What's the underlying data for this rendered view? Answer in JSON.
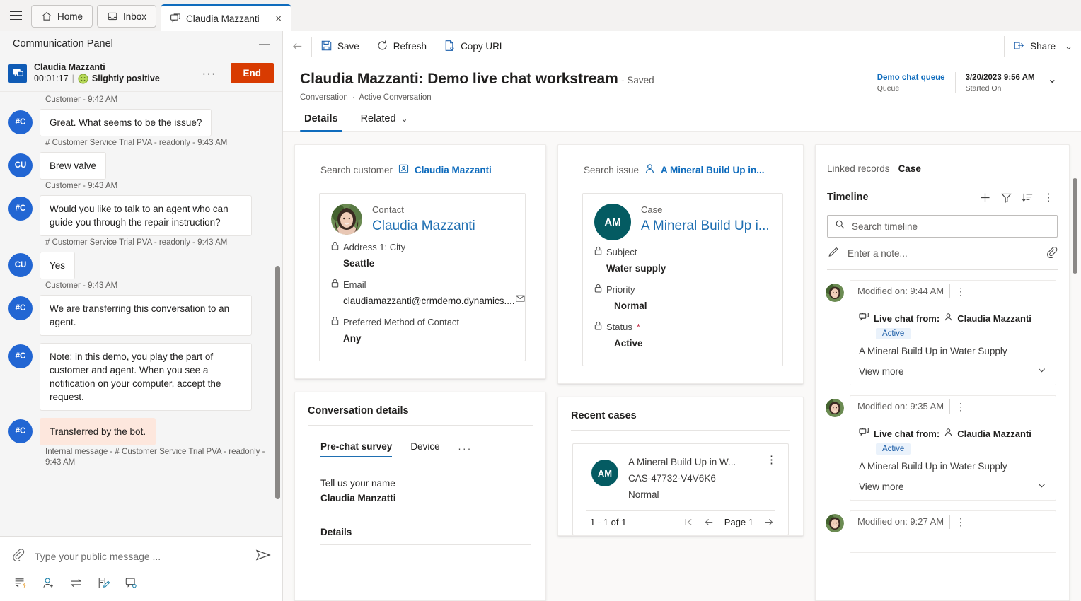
{
  "tabs": {
    "menu_icon": "hamburger-icon",
    "items": [
      {
        "label": "Home",
        "icon": "home-icon",
        "active": false
      },
      {
        "label": "Inbox",
        "icon": "inbox-icon",
        "active": false
      },
      {
        "label": "Claudia Mazzanti",
        "icon": "chat-icon",
        "active": true,
        "close": "×"
      }
    ]
  },
  "communication_panel": {
    "title": "Communication Panel",
    "minimize": "—",
    "conversation": {
      "name": "Claudia Mazzanti",
      "duration": "00:01:17",
      "separator": "|",
      "sentiment": "Slightly positive",
      "sentiment_icon": "smiley-icon",
      "more": "···",
      "end_label": "End"
    },
    "messages": [
      {
        "type": "meta",
        "text": "Customer - 9:42 AM"
      },
      {
        "type": "msg",
        "avatar": "#C",
        "text": "Great. What seems to be the issue?",
        "style": "normal"
      },
      {
        "type": "meta",
        "text": "# Customer Service Trial PVA - readonly - 9:43 AM"
      },
      {
        "type": "msg",
        "avatar": "CU",
        "text": "Brew valve",
        "style": "normal"
      },
      {
        "type": "meta",
        "text": "Customer - 9:43 AM"
      },
      {
        "type": "msg",
        "avatar": "#C",
        "text": "Would you like to talk to an agent who can guide you through the repair instruction?",
        "style": "normal"
      },
      {
        "type": "meta",
        "text": "# Customer Service Trial PVA - readonly - 9:43 AM"
      },
      {
        "type": "msg",
        "avatar": "CU",
        "text": "Yes",
        "style": "normal"
      },
      {
        "type": "meta",
        "text": "Customer - 9:43 AM"
      },
      {
        "type": "msg",
        "avatar": "#C",
        "text": "We are transferring this conversation to an agent.",
        "style": "normal"
      },
      {
        "type": "msg",
        "avatar": "#C",
        "text": "Note: in this demo, you play the part of customer and agent. When you see a notification on your computer, accept the request.",
        "style": "normal"
      },
      {
        "type": "msg",
        "avatar": "#C",
        "text": "Transferred by the bot.",
        "style": "internal"
      },
      {
        "type": "meta",
        "text": "Internal message - # Customer Service Trial PVA - readonly - 9:43 AM"
      }
    ],
    "composer": {
      "attach_icon": "paperclip-icon",
      "placeholder": "Type your public message ...",
      "value": "",
      "send_icon": "send-icon",
      "tools": [
        {
          "name": "quick-reply-icon"
        },
        {
          "name": "consult-icon"
        },
        {
          "name": "transfer-icon"
        },
        {
          "name": "notes-icon"
        },
        {
          "name": "linked-conversation-icon"
        }
      ]
    }
  },
  "command_bar": {
    "back_icon": "back-arrow-icon",
    "save": "Save",
    "refresh": "Refresh",
    "copy_url": "Copy URL",
    "share": "Share",
    "share_chevron": "⌄"
  },
  "record": {
    "title": "Claudia Mazzanti: Demo live chat workstream",
    "saved_state": "- Saved",
    "breadcrumb_entity": "Conversation",
    "breadcrumb_form": "Active Conversation",
    "breadcrumb_sep": "·",
    "header_fields": [
      {
        "value": "Demo chat queue",
        "label": "Queue",
        "link": true
      },
      {
        "value": "3/20/2023 9:56 AM",
        "label": "Started On",
        "link": false
      }
    ],
    "header_chevron": "⌄"
  },
  "form_tabs": [
    {
      "label": "Details",
      "active": true
    },
    {
      "label": "Related",
      "active": false,
      "chevron": "⌄"
    }
  ],
  "customer_card": {
    "search_label": "Search customer",
    "search_value": "Claudia Mazzanti",
    "search_icon": "contact-card-icon",
    "entity_type": "Contact",
    "entity_name": "Claudia Mazzanti",
    "avatar": "photo-avatar",
    "fields": [
      {
        "label": "Address 1: City",
        "value": "Seattle",
        "locked": true
      },
      {
        "label": "Email",
        "value": "claudiamazzanti@crmdemo.dynamics....",
        "locked": true,
        "trailing_icon": "email-icon"
      },
      {
        "label": "Preferred Method of Contact",
        "value": "Any",
        "locked": true
      }
    ]
  },
  "issue_card": {
    "search_label": "Search issue",
    "search_value": "A Mineral Build Up in...",
    "search_icon": "person-icon",
    "entity_type": "Case",
    "entity_name": "A Mineral Build Up i...",
    "initials": "AM",
    "fields": [
      {
        "label": "Subject",
        "value": "Water supply",
        "locked": true
      },
      {
        "label": "Priority",
        "value": "Normal",
        "locked": true
      },
      {
        "label": "Status",
        "value": "Active",
        "locked": true,
        "required": "*"
      }
    ]
  },
  "conversation_details": {
    "title": "Conversation details",
    "tabs": [
      {
        "label": "Pre-chat survey",
        "active": true
      },
      {
        "label": "Device",
        "active": false
      },
      {
        "label": "...",
        "active": false
      }
    ],
    "question": "Tell us your name",
    "answer": "Claudia Manzatti",
    "details_header": "Details"
  },
  "recent_cases": {
    "title": "Recent cases",
    "items": [
      {
        "initials": "AM",
        "title": "A Mineral Build Up in W...",
        "number": "CAS-47732-V4V6K6",
        "priority": "Normal",
        "kebab": "⋮"
      }
    ],
    "pager": {
      "count": "1 - 1 of 1",
      "first": "first-page-icon",
      "prev": "prev-page-icon",
      "page": "Page 1",
      "next": "next-page-icon"
    }
  },
  "timeline": {
    "linked_records_label": "Linked records",
    "linked_records_value": "Case",
    "title": "Timeline",
    "actions": [
      {
        "name": "add-icon",
        "glyph": "+"
      },
      {
        "name": "filter-icon",
        "glyph": "filter"
      },
      {
        "name": "sort-icon",
        "glyph": "sort"
      },
      {
        "name": "more-commands-icon",
        "glyph": "⋮"
      }
    ],
    "search_placeholder": "Search timeline",
    "search_value": "",
    "note_placeholder": "Enter a note...",
    "note_attach_icon": "paperclip-icon",
    "items": [
      {
        "time": "Modified on: 9:44 AM",
        "kebab": "⋮",
        "from_label": "Live chat from:",
        "from_person": "Claudia Mazzanti",
        "status": "Active",
        "description": "A Mineral Build Up in Water Supply",
        "view_more": "View more"
      },
      {
        "time": "Modified on: 9:35 AM",
        "kebab": "⋮",
        "from_label": "Live chat from:",
        "from_person": "Claudia Mazzanti",
        "status": "Active",
        "description": "A Mineral Build Up in Water Supply",
        "view_more": "View more"
      },
      {
        "time": "Modified on: 9:27 AM",
        "kebab": "⋮",
        "from_label": "",
        "from_person": "",
        "status": "",
        "description": "",
        "view_more": ""
      }
    ]
  },
  "colors": {
    "accent": "#0f6cbd",
    "end_button": "#d83b01",
    "case_avatar": "#045b62",
    "bot_avatar": "#2266d3",
    "internal_message": "#fde7dd",
    "status_badge_bg": "#eaf2fb"
  }
}
